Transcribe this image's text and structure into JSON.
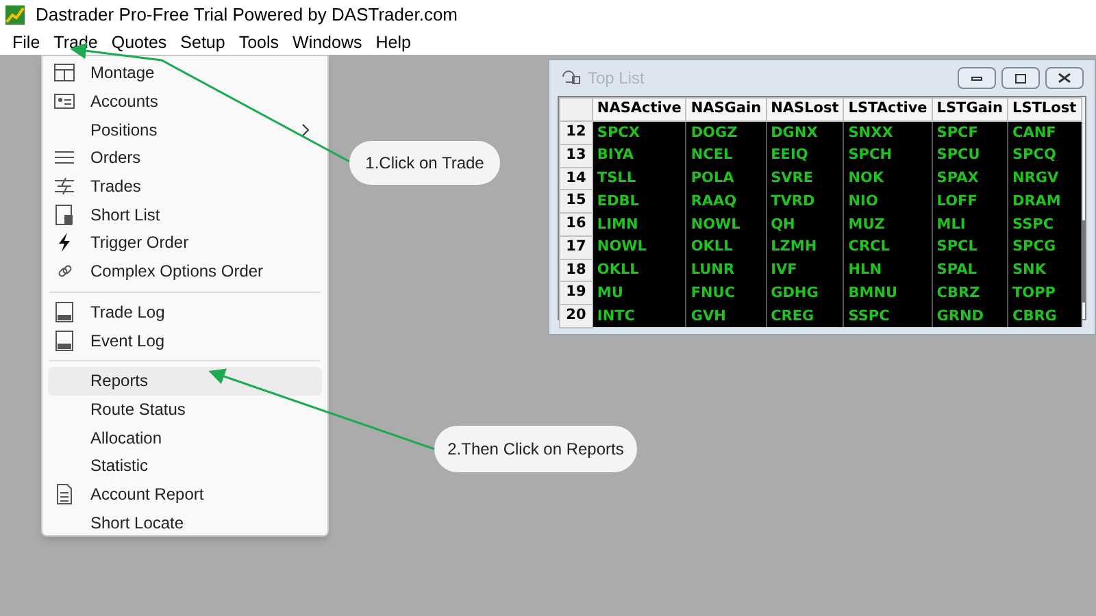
{
  "window": {
    "title": "Dastrader Pro-Free Trial Powered by DASTrader.com"
  },
  "menu_bar": [
    "File",
    "Trade",
    "Quotes",
    "Setup",
    "Tools",
    "Windows",
    "Help"
  ],
  "trade_menu": {
    "sections": [
      [
        {
          "label": "Montage",
          "submenu": false,
          "selected": false
        },
        {
          "label": "Accounts",
          "submenu": false,
          "selected": false
        },
        {
          "label": "Positions",
          "submenu": true,
          "selected": false
        },
        {
          "label": "Orders",
          "submenu": false,
          "selected": false
        },
        {
          "label": "Trades",
          "submenu": false,
          "selected": false
        },
        {
          "label": "Short List",
          "submenu": false,
          "selected": false
        },
        {
          "label": "Trigger Order",
          "submenu": false,
          "selected": false
        },
        {
          "label": "Complex Options Order",
          "submenu": false,
          "selected": false
        }
      ],
      [
        {
          "label": "Trade Log",
          "submenu": false,
          "selected": false
        },
        {
          "label": "Event Log",
          "submenu": false,
          "selected": false
        }
      ],
      [
        {
          "label": "Reports",
          "submenu": false,
          "selected": true
        },
        {
          "label": "Route Status",
          "submenu": false,
          "selected": false
        },
        {
          "label": "Allocation",
          "submenu": false,
          "selected": false
        },
        {
          "label": "Statistic",
          "submenu": false,
          "selected": false
        },
        {
          "label": "Account Report",
          "submenu": false,
          "selected": false
        },
        {
          "label": "Short Locate",
          "submenu": false,
          "selected": false
        }
      ]
    ]
  },
  "top_list": {
    "title": "Top List",
    "columns": [
      "NASActive",
      "NASGain",
      "NASLost",
      "LSTActive",
      "LSTGain",
      "LSTLost"
    ],
    "rows": [
      {
        "number": "12",
        "cells": [
          "SPCX",
          "DOGZ",
          "DGNX",
          "SNXX",
          "SPCF",
          "CANF"
        ]
      },
      {
        "number": "13",
        "cells": [
          "BIYA",
          "NCEL",
          "EEIQ",
          "SPCH",
          "SPCU",
          "SPCQ"
        ]
      },
      {
        "number": "14",
        "cells": [
          "TSLL",
          "POLA",
          "SVRE",
          "NOK",
          "SPAX",
          "NRGV"
        ]
      },
      {
        "number": "15",
        "cells": [
          "EDBL",
          "RAAQ",
          "TVRD",
          "NIO",
          "LOFF",
          "DRAM"
        ]
      },
      {
        "number": "16",
        "cells": [
          "LIMN",
          "NOWL",
          "QH",
          "MUZ",
          "MLI",
          "SSPC"
        ]
      },
      {
        "number": "17",
        "cells": [
          "NOWL",
          "OKLL",
          "LZMH",
          "CRCL",
          "SPCL",
          "SPCG"
        ]
      },
      {
        "number": "18",
        "cells": [
          "OKLL",
          "LUNR",
          "IVF",
          "HLN",
          "SPAL",
          "SNK"
        ]
      },
      {
        "number": "19",
        "cells": [
          "MU",
          "FNUC",
          "GDHG",
          "BMNU",
          "CBRZ",
          "TOPP"
        ]
      },
      {
        "number": "20",
        "cells": [
          "INTC",
          "GVH",
          "CREG",
          "SSPC",
          "GRND",
          "CBRG"
        ]
      }
    ]
  },
  "callouts": [
    "1.Click on Trade",
    "2.Then Click on Reports"
  ]
}
